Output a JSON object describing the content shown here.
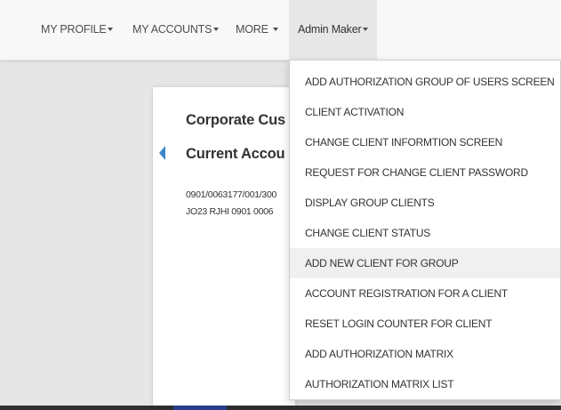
{
  "navbar": {
    "items": [
      {
        "label": "MY PROFILE",
        "caret": true
      },
      {
        "label": "MY ACCOUNTS",
        "caret": true
      },
      {
        "label": "MORE",
        "caret": true
      },
      {
        "label": "Admin Maker",
        "caret": true,
        "active": true
      }
    ]
  },
  "card": {
    "title": "Corporate Cus",
    "subtitle": "Current Accou",
    "account_number": "0901/0063177/001/300",
    "iban": "JO23 RJHI 0901 0006"
  },
  "dropdown": {
    "items": [
      "ADD AUTHORIZATION GROUP OF USERS SCREEN",
      "CLIENT ACTIVATION",
      "CHANGE CLIENT INFORMTION SCREEN",
      "REQUEST FOR CHANGE CLIENT PASSWORD",
      "DISPLAY GROUP CLIENTS",
      "CHANGE CLIENT STATUS",
      "ADD NEW CLIENT FOR GROUP",
      "ACCOUNT REGISTRATION FOR A CLIENT",
      "RESET LOGIN COUNTER FOR CLIENT",
      "ADD AUTHORIZATION MATRIX",
      "AUTHORIZATION MATRIX LIST"
    ],
    "hovered_item": "ADD NEW CLIENT FOR GROUP"
  },
  "colors": {
    "accent": "#3a87c8",
    "navbar_bg": "#f8f8f8",
    "active_bg": "#e7e7e7"
  }
}
